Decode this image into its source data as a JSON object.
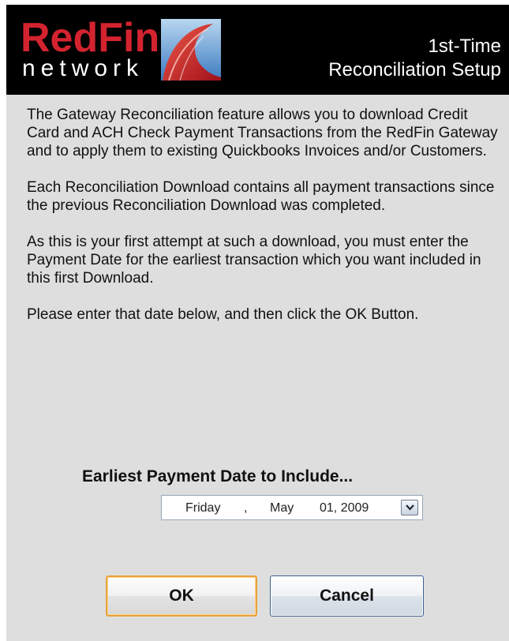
{
  "header": {
    "logo": {
      "brand": "RedFin",
      "sub": "network",
      "brand_color": "#d3232f"
    },
    "title_line1": "1st-Time",
    "title_line2": "Reconciliation Setup"
  },
  "content": {
    "paragraphs": [
      "The Gateway Reconciliation feature allows you to download Credit Card and ACH Check Payment Transactions from the RedFin Gateway and to apply them to existing Quickbooks Invoices and/or Customers.",
      "Each Reconciliation Download contains all payment transactions since the previous Reconciliation Download was completed.",
      "As this is your first attempt at such a download, you must enter the Payment Date for the earliest transaction which you want included in this first Download.",
      "Please enter that date below, and then click the OK Button."
    ]
  },
  "date_field": {
    "label": "Earliest Payment Date to Include...",
    "weekday": "Friday",
    "sep1": ",",
    "month": "May",
    "day_year": "01, 2009",
    "dropdown_icon": "chevron-down-icon"
  },
  "buttons": {
    "ok": "OK",
    "cancel": "Cancel",
    "ok_border_color": "#e8a33a",
    "cancel_border_color": "#3c5f94"
  }
}
